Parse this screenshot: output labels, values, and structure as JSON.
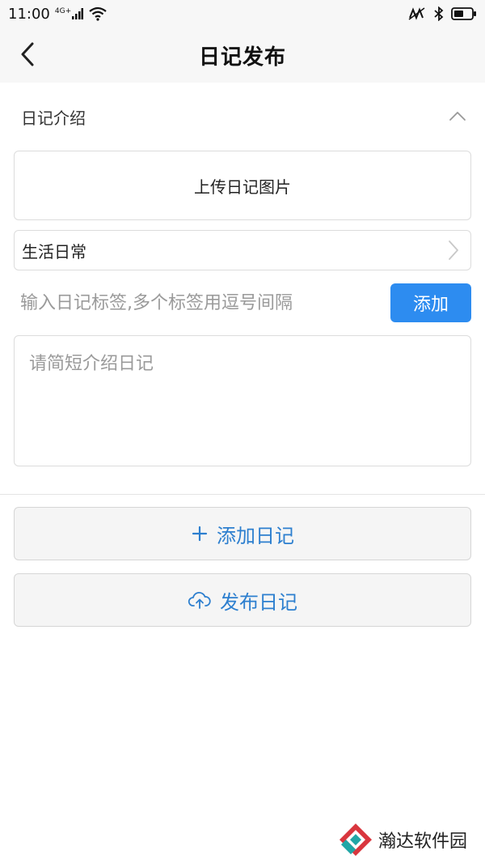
{
  "status_bar": {
    "time": "11:00",
    "network": "4G+"
  },
  "header": {
    "title": "日记发布"
  },
  "section": {
    "title": "日记介绍"
  },
  "upload": {
    "label": "上传日记图片"
  },
  "category": {
    "value": "生活日常"
  },
  "tags": {
    "placeholder": "输入日记标签,多个标签用逗号间隔",
    "add_label": "添加"
  },
  "intro": {
    "placeholder": "请简短介绍日记"
  },
  "actions": {
    "add_label": "添加日记",
    "publish_label": "发布日记"
  },
  "watermark": {
    "text": "瀚达软件园"
  },
  "colors": {
    "accent": "#2d8cf0",
    "action_text": "#2d7fcf",
    "header_bg": "#f7f7f7"
  }
}
